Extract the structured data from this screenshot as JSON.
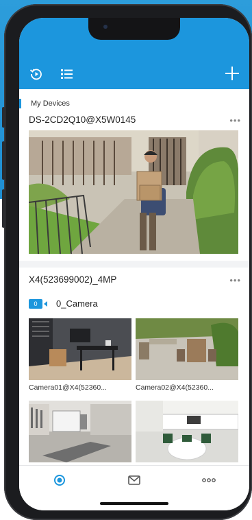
{
  "header": {
    "playback_icon": "playback-icon",
    "list_icon": "list-icon",
    "add_icon": "plus-icon"
  },
  "section": {
    "label": "My Devices"
  },
  "devices": [
    {
      "name": "DS-2CD2Q10@X5W0145",
      "more": "•••"
    },
    {
      "name": "X4(523699002)_4MP",
      "more": "•••"
    }
  ],
  "camera_group": {
    "badge": "0",
    "name": "0_Camera"
  },
  "cameras": [
    {
      "caption": "Camera01@X4(52360..."
    },
    {
      "caption": "Camera02@X4(52360..."
    },
    {
      "caption": ""
    },
    {
      "caption": ""
    }
  ],
  "tabbar": {
    "tabs": [
      {
        "icon": "home-icon",
        "active": true
      },
      {
        "icon": "message-icon",
        "active": false
      },
      {
        "icon": "more-icon",
        "active": false
      }
    ]
  },
  "colors": {
    "accent": "#1c96dd",
    "background": "#2d9ddb"
  }
}
